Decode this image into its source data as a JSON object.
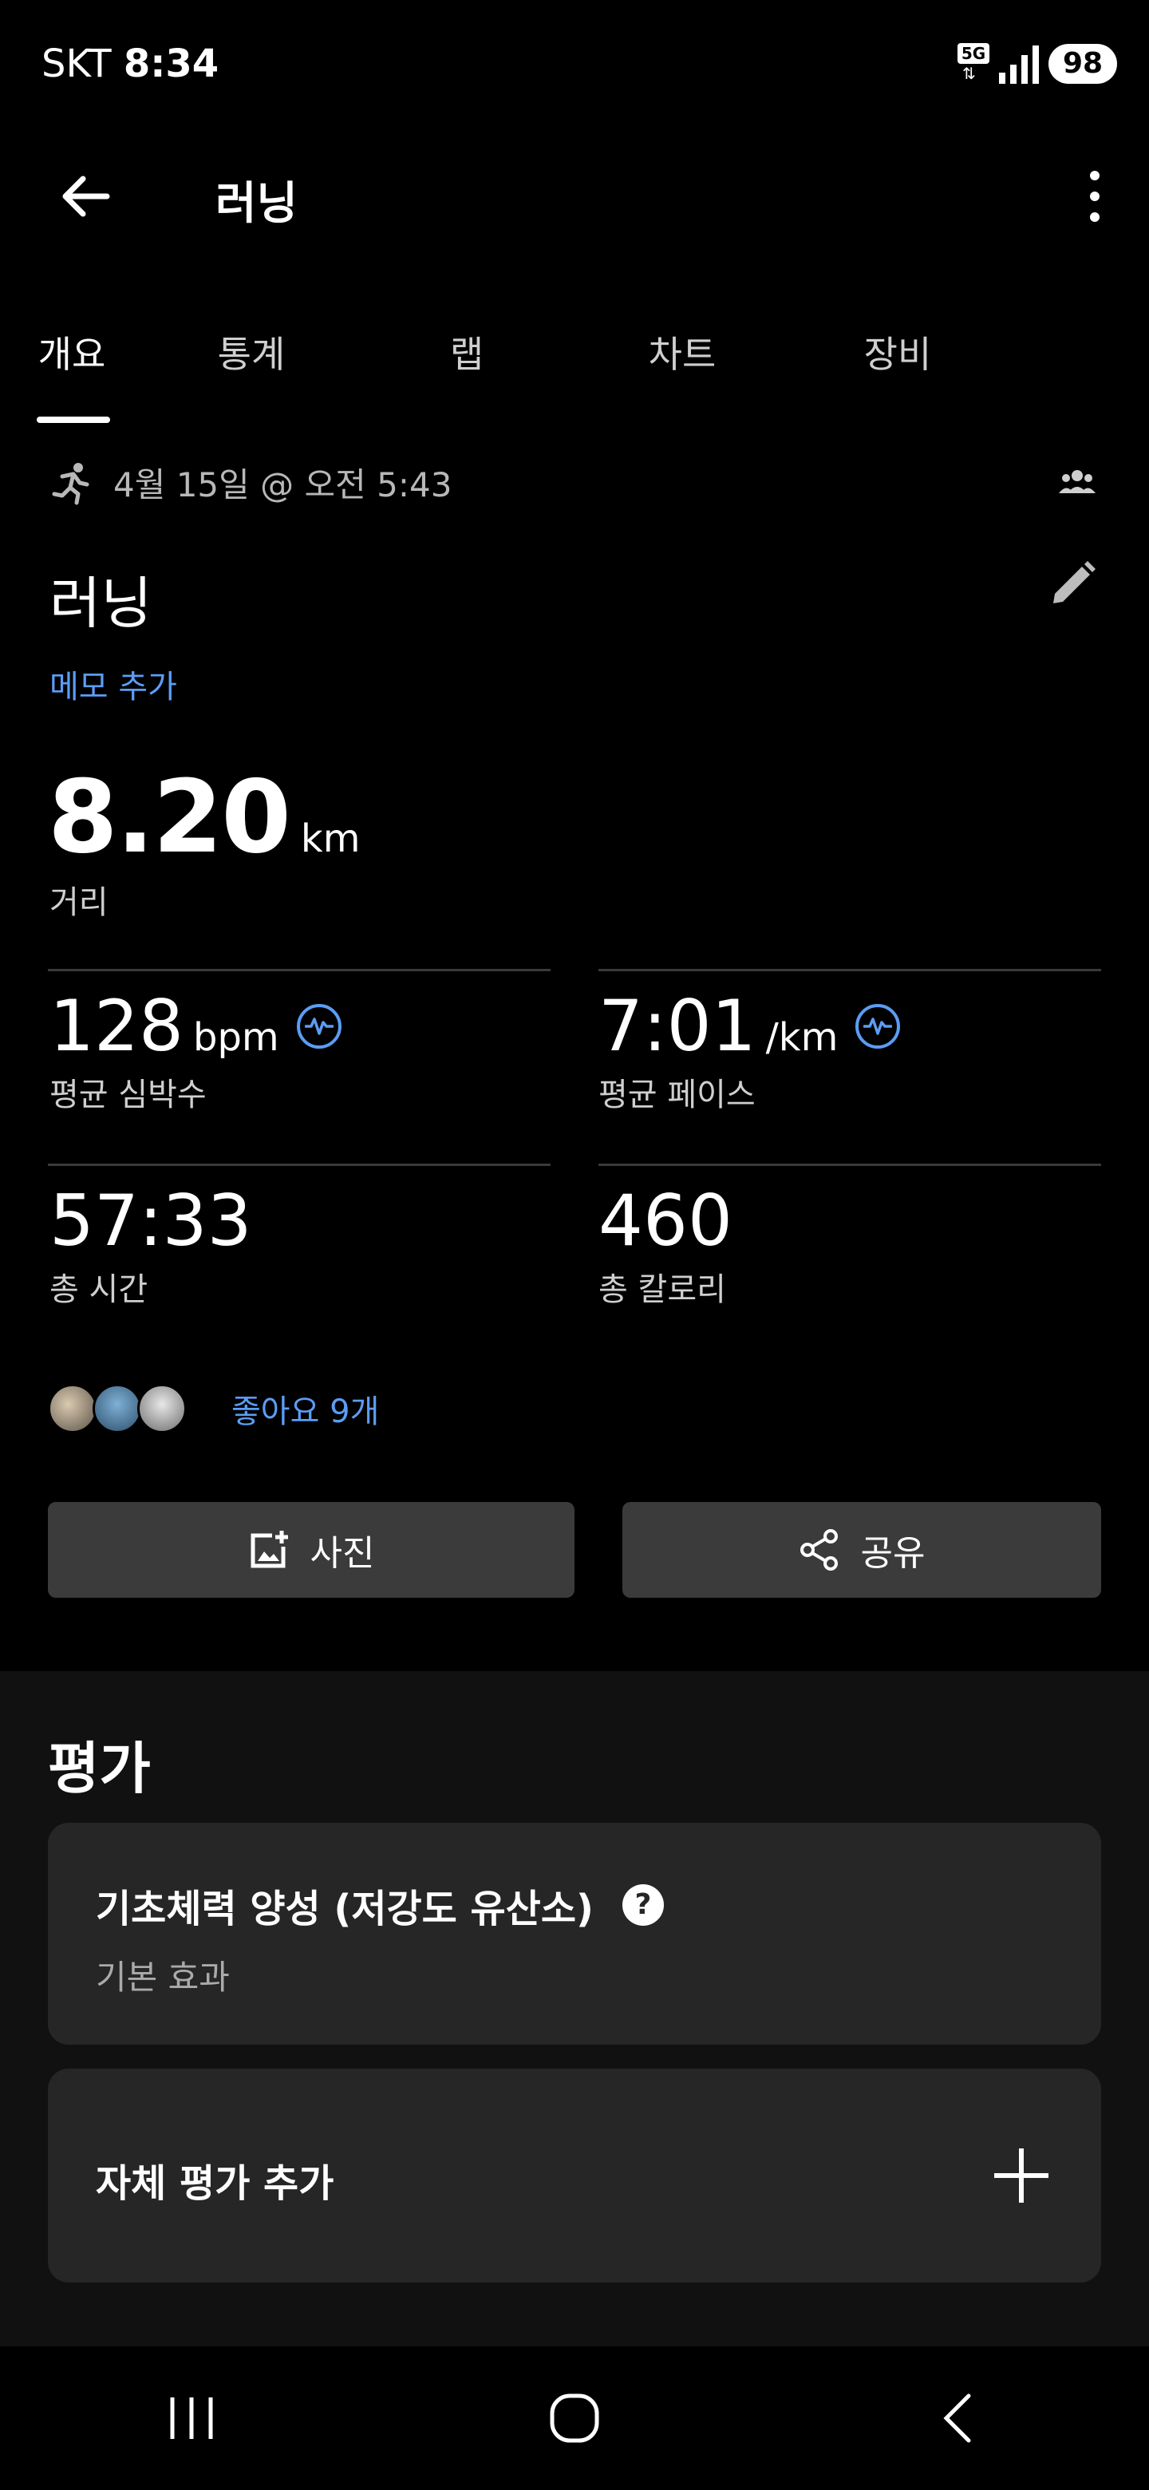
{
  "status_bar": {
    "carrier": "SKT",
    "time": "8:34",
    "network": "5G",
    "battery": "98"
  },
  "app_bar": {
    "title": "러닝"
  },
  "tabs": [
    {
      "label": "개요",
      "active": true
    },
    {
      "label": "통계"
    },
    {
      "label": "랩"
    },
    {
      "label": "차트"
    },
    {
      "label": "장비"
    }
  ],
  "activity": {
    "date": "4월 15일 @ 오전 5:43",
    "name": "러닝",
    "memo_link": "메모 추가",
    "distance": {
      "value": "8.20",
      "unit": "km",
      "label": "거리"
    }
  },
  "metrics": [
    {
      "value": "128",
      "unit": "bpm",
      "label": "평균 심박수",
      "icon": "heart-rate-icon"
    },
    {
      "value": "7:01",
      "unit": "/km",
      "label": "평균 페이스",
      "icon": "heart-rate-icon"
    },
    {
      "value": "57:33",
      "unit": "",
      "label": "총 시간"
    },
    {
      "value": "460",
      "unit": "",
      "label": "총 칼로리"
    }
  ],
  "likes": {
    "text": "좋아요 9개"
  },
  "actions": {
    "photo": "사진",
    "share": "공유"
  },
  "evaluation": {
    "title": "평가",
    "effect_title": "기초체력 양성 (저강도 유산소)",
    "effect_subtitle": "기본 효과",
    "self_eval": "자체 평가 추가"
  },
  "colors": {
    "accent": "#5b9df5",
    "background": "#000000",
    "card": "#262626"
  }
}
